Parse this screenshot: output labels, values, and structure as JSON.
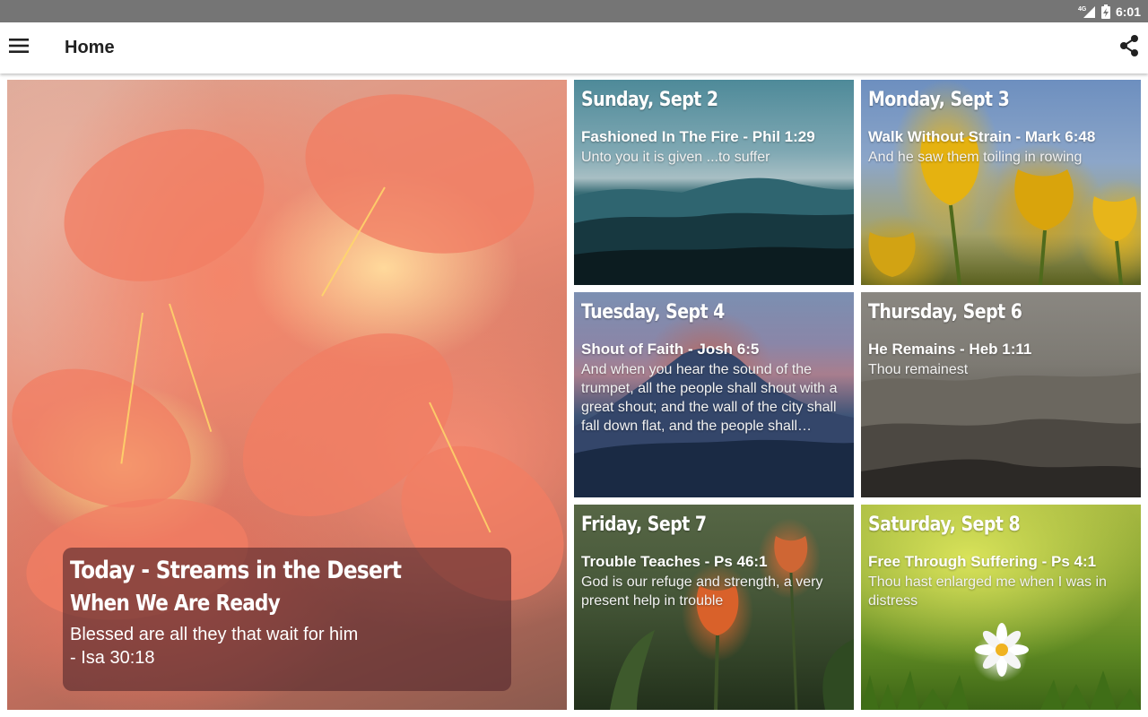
{
  "status_bar": {
    "network": "4G",
    "time": "6:01"
  },
  "app_bar": {
    "title": "Home",
    "menu_icon": "hamburger-menu-icon",
    "share_icon": "share-icon"
  },
  "featured": {
    "title": "Today - Streams in the Desert",
    "heading": "When We Are Ready",
    "verse": "Blessed are all they that wait for him",
    "reference": "- Isa 30:18"
  },
  "days": [
    {
      "date": "Sunday, Sept 2",
      "heading": "Fashioned In The Fire - Phil 1:29",
      "text": "Unto you it is given ...to suffer"
    },
    {
      "date": "Monday, Sept 3",
      "heading": "Walk Without Strain - Mark 6:48",
      "text": "And he saw them toiling in rowing"
    },
    {
      "date": "Tuesday, Sept 4",
      "heading": "Shout of Faith - Josh 6:5",
      "text": "And when you hear the sound of the trumpet, all the people shall shout with a great shout; and the wall of the city shall fall down flat, and the people shall…"
    },
    {
      "date": "Thursday, Sept 6",
      "heading": "He Remains - Heb 1:11",
      "text": "Thou remainest"
    },
    {
      "date": "Friday, Sept 7",
      "heading": "Trouble Teaches - Ps 46:1",
      "text": "God is our refuge and strength, a very present help in trouble"
    },
    {
      "date": "Saturday, Sept 8",
      "heading": "Free Through Suffering - Ps 4:1",
      "text": "Thou hast enlarged me when I was in distress"
    }
  ]
}
